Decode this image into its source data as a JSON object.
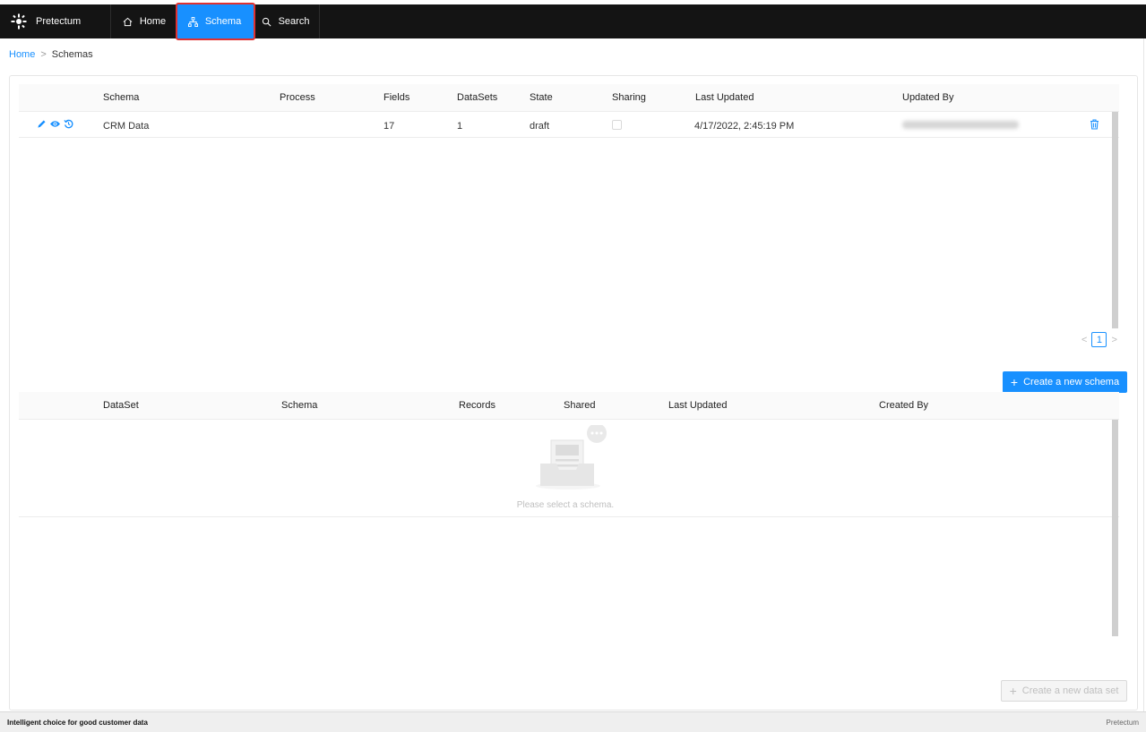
{
  "app": {
    "brand": "Pretectum"
  },
  "nav": {
    "home": "Home",
    "schema": "Schema",
    "search": "Search"
  },
  "breadcrumb": {
    "home": "Home",
    "separator": ">",
    "current": "Schemas"
  },
  "schemas_table": {
    "columns": [
      "Schema",
      "Process",
      "Fields",
      "DataSets",
      "State",
      "Sharing",
      "Last Updated",
      "Updated By"
    ],
    "rows": [
      {
        "schema": "CRM Data",
        "process": "",
        "fields": "17",
        "datasets": "1",
        "state": "draft",
        "sharing": false,
        "last_updated": "4/17/2022, 2:45:19 PM",
        "updated_by": ""
      }
    ]
  },
  "pagination": {
    "prev": "<",
    "current": "1",
    "next": ">"
  },
  "create_schema_button": "Create a new schema",
  "datasets_table": {
    "columns": [
      "DataSet",
      "Schema",
      "Records",
      "Shared",
      "Last Updated",
      "Created By"
    ],
    "empty_text": "Please select a schema."
  },
  "create_dataset_button": "Create a new data set",
  "footer": {
    "left": "Intelligent choice for good customer data",
    "right": "Pretectum"
  },
  "colors": {
    "primary": "#1890ff",
    "navbar": "#141414",
    "highlight": "#e03131"
  }
}
